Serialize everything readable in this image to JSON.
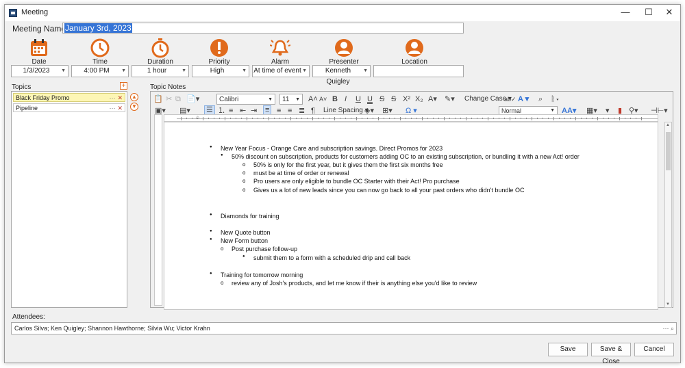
{
  "window": {
    "title": "Meeting",
    "minimize": "—",
    "maximize": "☐",
    "close": "✕"
  },
  "meeting_name": {
    "label": "Meeting Name:",
    "value": "January 3rd, 2023"
  },
  "fields": [
    {
      "label": "Date",
      "value": "1/3/2023",
      "icon": "calendar-icon"
    },
    {
      "label": "Time",
      "value": "4:00 PM",
      "icon": "clock-icon"
    },
    {
      "label": "Duration",
      "value": "1 hour",
      "icon": "stopwatch-icon"
    },
    {
      "label": "Priority",
      "value": "High",
      "icon": "priority-icon"
    },
    {
      "label": "Alarm",
      "value": "At time of event",
      "icon": "alarm-bell-icon"
    },
    {
      "label": "Presenter",
      "value": "Kenneth Quigley",
      "icon": "person-icon"
    },
    {
      "label": "Location",
      "value": "",
      "icon": "person-icon"
    }
  ],
  "topics": {
    "label": "Topics",
    "items": [
      "Black Friday Promo",
      "Pipeline"
    ],
    "item_menu": "···",
    "item_remove": "✕"
  },
  "notes_label": "Topic Notes",
  "toolbar": {
    "font": "Calibri",
    "size": "11",
    "change_case": "Change Case",
    "line_spacing": "Line Spacing",
    "style": "Normal"
  },
  "document": [
    {
      "level": 1,
      "text": "New Year Focus - Orange Care and subscription savings. Direct Promos for 2023"
    },
    {
      "level": 2,
      "text": "50% discount on subscription, products for customers adding OC to an existing subscription, or bundling it with a new Act! order"
    },
    {
      "level": 3,
      "text": "50% is only for the first year, but it gives them the first six months free"
    },
    {
      "level": 3,
      "text": "must be at time of order or renewal"
    },
    {
      "level": 3,
      "text": "Pro users are only eligible to bundle OC Starter with their Act! Pro purchase"
    },
    {
      "level": 3,
      "text": "Gives us a lot of new leads since you can now go back to all your past orders who didn't bundle OC"
    },
    {
      "level": 1,
      "text": "Diamonds for training"
    },
    {
      "level": 1,
      "text": "New Quote button"
    },
    {
      "level": 1,
      "text": "New Form button"
    },
    {
      "level": 2,
      "text": "Post purchase follow-up"
    },
    {
      "level": 3,
      "text": "submit them to a form with a scheduled drip and call back"
    },
    {
      "level": 1,
      "text": "Training for tomorrow morning"
    },
    {
      "level": 2,
      "text": "review any of Josh's products, and let me know if their is anything else you'd like to review"
    }
  ],
  "attendees": {
    "label": "Attendees:",
    "value": "Carlos Silva; Ken Quigley; Shannon Hawthorne; Silvia Wu; Victor Krahn",
    "actions": "··· ⌕"
  },
  "buttons": {
    "save": "Save",
    "save_close": "Save & Close",
    "cancel": "Cancel"
  },
  "colors": {
    "accent": "#e06a1c",
    "selection": "#3574d6",
    "topic_highlight": "#fdf6b5"
  }
}
